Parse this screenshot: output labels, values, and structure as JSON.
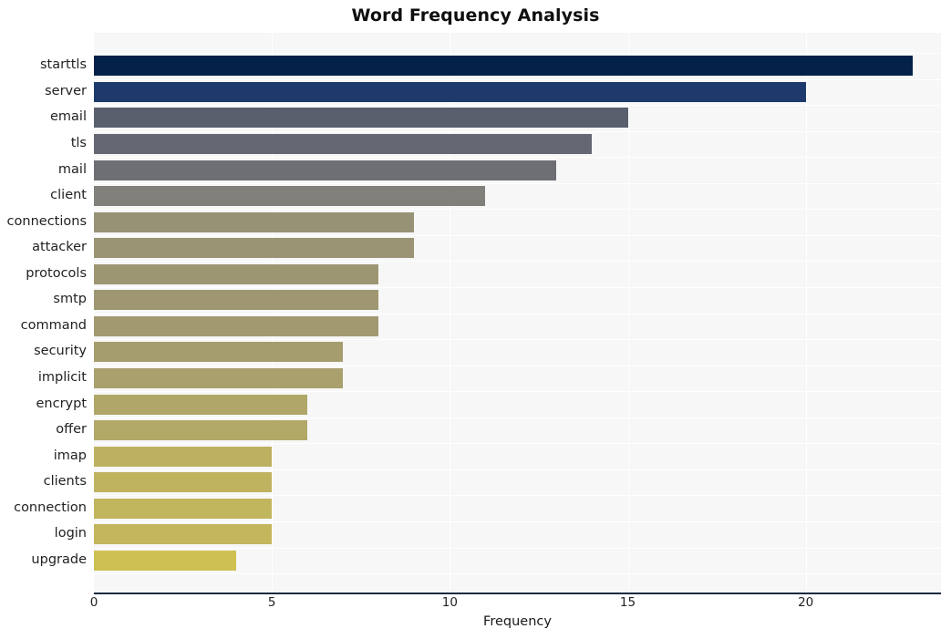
{
  "chart_data": {
    "type": "bar",
    "orientation": "horizontal",
    "title": "Word Frequency Analysis",
    "xlabel": "Frequency",
    "ylabel": "",
    "xlim": [
      0,
      23.8
    ],
    "ylim": [
      0,
      20
    ],
    "grid": true,
    "legend": null,
    "xticks": [
      0,
      5,
      10,
      15,
      20
    ],
    "xtick_labels": [
      "0",
      "5",
      "10",
      "15",
      "20"
    ],
    "categories": [
      "starttls",
      "server",
      "email",
      "tls",
      "mail",
      "client",
      "connections",
      "attacker",
      "protocols",
      "smtp",
      "command",
      "security",
      "implicit",
      "encrypt",
      "offer",
      "imap",
      "clients",
      "connection",
      "login",
      "upgrade"
    ],
    "values": [
      23,
      20,
      15,
      14,
      13,
      11,
      9,
      9,
      8,
      8,
      8,
      7,
      7,
      6,
      6,
      5,
      5,
      5,
      5,
      4
    ],
    "colors": [
      "#042149",
      "#1e3a6d",
      "#5a5f6e",
      "#656873",
      "#6d6f75",
      "#82807b",
      "#979275",
      "#9a9474",
      "#9d9672",
      "#9f9771",
      "#a19970",
      "#a69d6e",
      "#a9a06d",
      "#b0a668",
      "#b2a867",
      "#bdb161",
      "#bfb35f",
      "#c1b55e",
      "#c3b65c",
      "#cfc054"
    ],
    "background": "#f7f7f7",
    "gridline_color": "#ffffff",
    "axis_color": "#1b2a41"
  },
  "figure": {
    "title": "Word Frequency Analysis",
    "xaxis_title": "Frequency"
  }
}
